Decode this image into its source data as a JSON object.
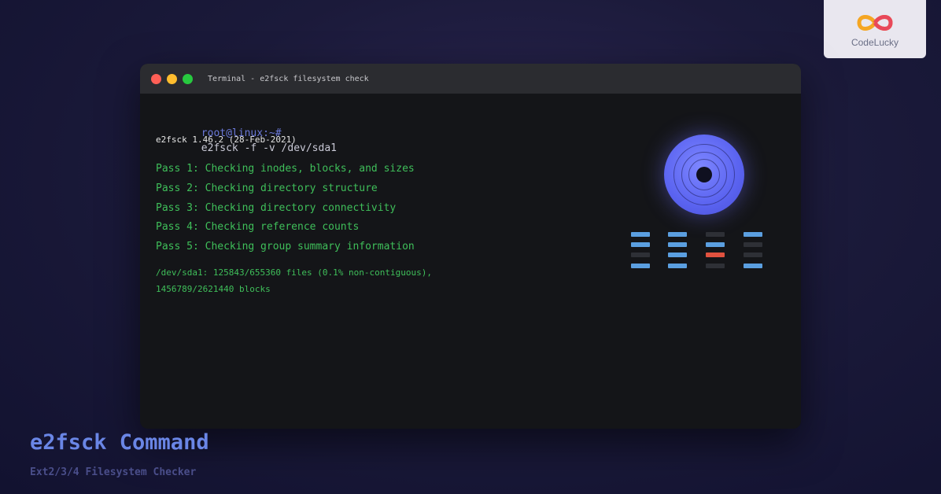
{
  "logo": {
    "text": "CodeLucky",
    "icon": "infinity-logo"
  },
  "window": {
    "title": "Terminal - e2fsck filesystem check"
  },
  "terminal": {
    "prompt_user": "root@linux:~#",
    "command": "e2fsck -f -v /dev/sda1",
    "version": "e2fsck 1.46.2 (28-Feb-2021)",
    "passes": [
      "Pass 1: Checking inodes, blocks, and sizes",
      "Pass 2: Checking directory structure",
      "Pass 3: Checking directory connectivity",
      "Pass 4: Checking reference counts",
      "Pass 5: Checking group summary information"
    ],
    "summary_1": "/dev/sda1: 125843/655360 files (0.1% non-contiguous),",
    "summary_2": "1456789/2621440 blocks"
  },
  "illustration": {
    "disk_icon": "disk-icon",
    "block_grid": [
      [
        "blue",
        "blue",
        "dark",
        "blue"
      ],
      [
        "blue",
        "blue",
        "blue",
        "dark"
      ],
      [
        "dark",
        "blue",
        "red",
        "dark"
      ],
      [
        "blue",
        "blue",
        "dark",
        "blue"
      ]
    ],
    "colors": {
      "blue": "#5b9fe0",
      "dark": "#2e3036",
      "red": "#e0523f"
    }
  },
  "footer": {
    "title": "e2fsck Command",
    "subtitle": "Ext2/3/4 Filesystem Checker"
  }
}
